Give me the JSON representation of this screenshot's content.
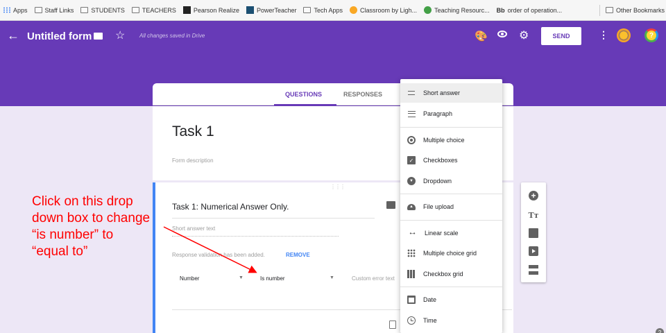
{
  "bookmarks": {
    "items": [
      {
        "label": "Apps",
        "icon": "apps-grid-icon"
      },
      {
        "label": "Staff Links",
        "icon": "folder-icon"
      },
      {
        "label": "STUDENTS",
        "icon": "folder-icon"
      },
      {
        "label": "TEACHERS",
        "icon": "folder-icon"
      },
      {
        "label": "Pearson Realize",
        "icon": "pearson-icon"
      },
      {
        "label": "PowerTeacher",
        "icon": "powerteacher-icon"
      },
      {
        "label": "Tech Apps",
        "icon": "folder-icon"
      },
      {
        "label": "Classroom by Ligh...",
        "icon": "classroom-icon"
      },
      {
        "label": "Teaching Resourc...",
        "icon": "teaching-icon"
      },
      {
        "label": "order of operation...",
        "icon": "blackboard-icon",
        "prefix": "Bb"
      }
    ],
    "other": "Other Bookmarks"
  },
  "header": {
    "title": "Untitled form",
    "saved_status": "All changes saved in Drive",
    "send_label": "SEND"
  },
  "tabs": {
    "questions": "QUESTIONS",
    "responses": "RESPONSES"
  },
  "form": {
    "title": "Task 1",
    "description_placeholder": "Form description"
  },
  "question": {
    "title": "Task 1: Numerical Answer Only.",
    "answer_hint": "Short answer text",
    "validation_text": "Response validation has been added.",
    "remove_label": "REMOVE",
    "validation_type": "Number",
    "validation_condition": "Is number",
    "error_placeholder": "Custom error text"
  },
  "type_menu": {
    "items": [
      {
        "label": "Short answer",
        "icon": "short-answer-icon"
      },
      {
        "label": "Paragraph",
        "icon": "paragraph-icon"
      },
      {
        "label": "Multiple choice",
        "icon": "radio-icon"
      },
      {
        "label": "Checkboxes",
        "icon": "checkbox-icon"
      },
      {
        "label": "Dropdown",
        "icon": "dropdown-icon"
      },
      {
        "label": "File upload",
        "icon": "cloud-upload-icon"
      },
      {
        "label": "Linear scale",
        "icon": "linear-scale-icon"
      },
      {
        "label": "Multiple choice grid",
        "icon": "grid-dots-icon"
      },
      {
        "label": "Checkbox grid",
        "icon": "grid-squares-icon"
      },
      {
        "label": "Date",
        "icon": "calendar-icon"
      },
      {
        "label": "Time",
        "icon": "clock-icon"
      }
    ],
    "selected": "Short answer"
  },
  "annotation": {
    "lines": [
      "Click on this drop",
      "down box to change",
      "“is number” to",
      "“equal to”"
    ],
    "color": "#ff0000"
  },
  "colors": {
    "brand_purple": "#673ab7",
    "accent_blue": "#4285f4",
    "background": "#ede7f6"
  }
}
